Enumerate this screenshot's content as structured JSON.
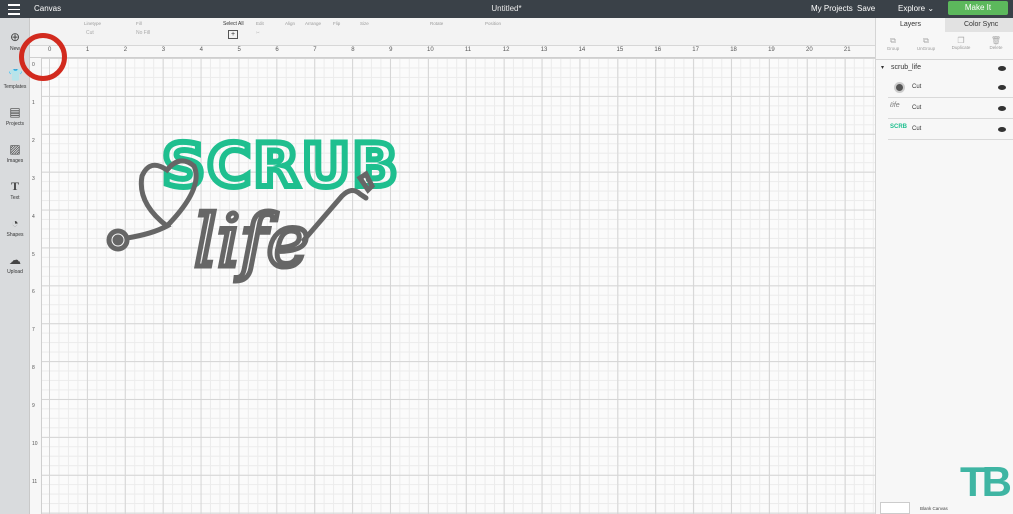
{
  "topbar": {
    "app_title": "Canvas",
    "doc_title": "Untitled*",
    "my_projects": "My Projects",
    "save": "Save",
    "explore": "Explore",
    "make_it": "Make It"
  },
  "leftbar": {
    "items": [
      {
        "label": "New",
        "icon": "plus-icon"
      },
      {
        "label": "Templates",
        "icon": "shirt-icon"
      },
      {
        "label": "Projects",
        "icon": "projects-icon"
      },
      {
        "label": "Images",
        "icon": "image-icon"
      },
      {
        "label": "Text",
        "icon": "text-icon"
      },
      {
        "label": "Shapes",
        "icon": "shapes-icon"
      },
      {
        "label": "Upload",
        "icon": "cloud-upload-icon"
      }
    ]
  },
  "editbar": {
    "linetype_label": "Linetype",
    "linetype_value": "Cut",
    "fill_label": "Fill",
    "fill_value": "No Fill",
    "select_all": "Select All",
    "edit": "Edit",
    "align": "Align",
    "arrange": "Arrange",
    "flip": "Flip",
    "size": "Size",
    "rotate": "Rotate",
    "position": "Position"
  },
  "ruler": {
    "top": [
      "0",
      "1",
      "2",
      "3",
      "4",
      "5",
      "6",
      "7",
      "8",
      "9",
      "10",
      "11",
      "12",
      "13",
      "14",
      "15",
      "16",
      "17",
      "18",
      "19",
      "20",
      "21"
    ],
    "left": [
      "0",
      "1",
      "2",
      "3",
      "4",
      "5",
      "6",
      "7",
      "8",
      "9",
      "10",
      "11"
    ]
  },
  "canvas_art": {
    "scrub_text": "SCRUB",
    "life_text": "life",
    "scrub_color": "#1fbf8f",
    "life_color": "#666666"
  },
  "rightpanel": {
    "tabs": [
      "Layers",
      "Color Sync"
    ],
    "actions": [
      "Group",
      "UnGroup",
      "Duplicate",
      "Delete"
    ],
    "group_name": "scrub_life",
    "layers": [
      {
        "label": "Cut"
      },
      {
        "label": "Cut"
      },
      {
        "label": "Cut"
      }
    ],
    "blank_canvas": "Blank Canvas"
  },
  "watermark": "TB",
  "colors": {
    "topbar": "#3a4148",
    "make_it": "#5cb85c",
    "highlight": "#d22a1e"
  }
}
